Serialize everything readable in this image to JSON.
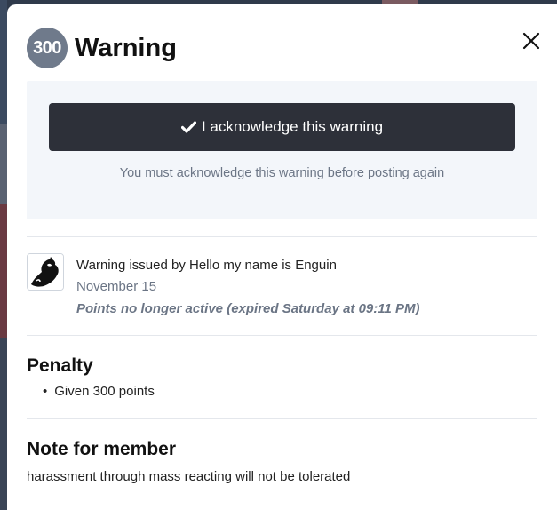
{
  "modal": {
    "badge_points": "300",
    "title": "Warning",
    "close_icon": "close-icon"
  },
  "acknowledge": {
    "button_label": "I acknowledge this warning",
    "button_icon": "check-icon",
    "note": "You must acknowledge this warning before posting again"
  },
  "issuer": {
    "avatar_icon": "avatar",
    "issued_by": "Warning issued by Hello my name is Enguin",
    "date": "November 15",
    "points_status": "Points no longer active (expired Saturday at 09:11 PM)"
  },
  "penalty": {
    "heading": "Penalty",
    "items": [
      "Given 300 points"
    ]
  },
  "member_note": {
    "heading": "Note for member",
    "text": "harassment through mass reacting will not be tolerated"
  },
  "colors": {
    "badge_bg": "#6f7a8b",
    "button_bg": "#2d3039",
    "panel_bg": "#f3f6fa",
    "muted_text": "#6b7585"
  }
}
